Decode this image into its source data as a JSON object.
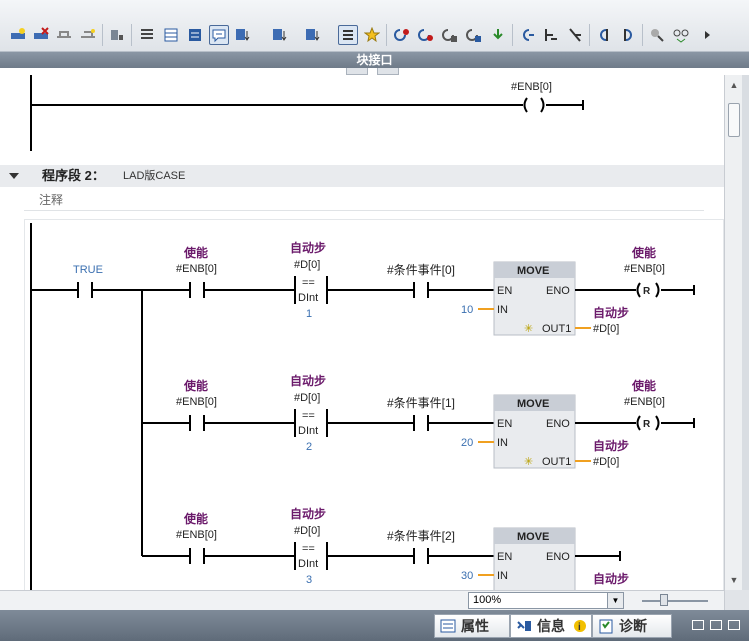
{
  "interface_bar": {
    "title": "块接口"
  },
  "top_rung": {
    "output_label": "#ENB[0]"
  },
  "segment": {
    "title": "程序段 2：",
    "subtitle": "LAD版CASE",
    "comment": "注释"
  },
  "network": {
    "true_label": "TRUE",
    "rungs": [
      {
        "enable_label": "使能",
        "enable_var": "#ENB[0]",
        "cmp_label": "自动步",
        "cmp_var": "#D[0]",
        "cmp_op": "==",
        "cmp_type": "DInt",
        "cmp_value": "1",
        "event_var": "#条件事件[0]",
        "move_title": "MOVE",
        "move_en": "EN",
        "move_eno": "ENO",
        "move_in": "IN",
        "move_out": "OUT1",
        "in_value": "10",
        "out_label": "自动步",
        "out_var": "#D[0]",
        "coil_label": "使能",
        "coil_var": "#ENB[0]",
        "coil_type": "R"
      },
      {
        "enable_label": "使能",
        "enable_var": "#ENB[0]",
        "cmp_label": "自动步",
        "cmp_var": "#D[0]",
        "cmp_op": "==",
        "cmp_type": "DInt",
        "cmp_value": "2",
        "event_var": "#条件事件[1]",
        "move_title": "MOVE",
        "move_en": "EN",
        "move_eno": "ENO",
        "move_in": "IN",
        "move_out": "OUT1",
        "in_value": "20",
        "out_label": "自动步",
        "out_var": "#D[0]",
        "coil_label": "使能",
        "coil_var": "#ENB[0]",
        "coil_type": "R"
      },
      {
        "enable_label": "使能",
        "enable_var": "#ENB[0]",
        "cmp_label": "自动步",
        "cmp_var": "#D[0]",
        "cmp_op": "==",
        "cmp_type": "DInt",
        "cmp_value": "3",
        "event_var": "#条件事件[2]",
        "move_title": "MOVE",
        "move_en": "EN",
        "move_eno": "ENO",
        "move_in": "IN",
        "in_value": "30",
        "out_label": "自动步"
      }
    ]
  },
  "zoom": {
    "value": "100%"
  },
  "status_tabs": {
    "properties": "属性",
    "info": "信息",
    "diagnostics": "诊断"
  },
  "colors": {
    "symbol_purple": "#6b1a6b",
    "constant_blue": "#3a6fb0",
    "wire_orange": "#f0a020",
    "box_header": "#c9ced6"
  }
}
